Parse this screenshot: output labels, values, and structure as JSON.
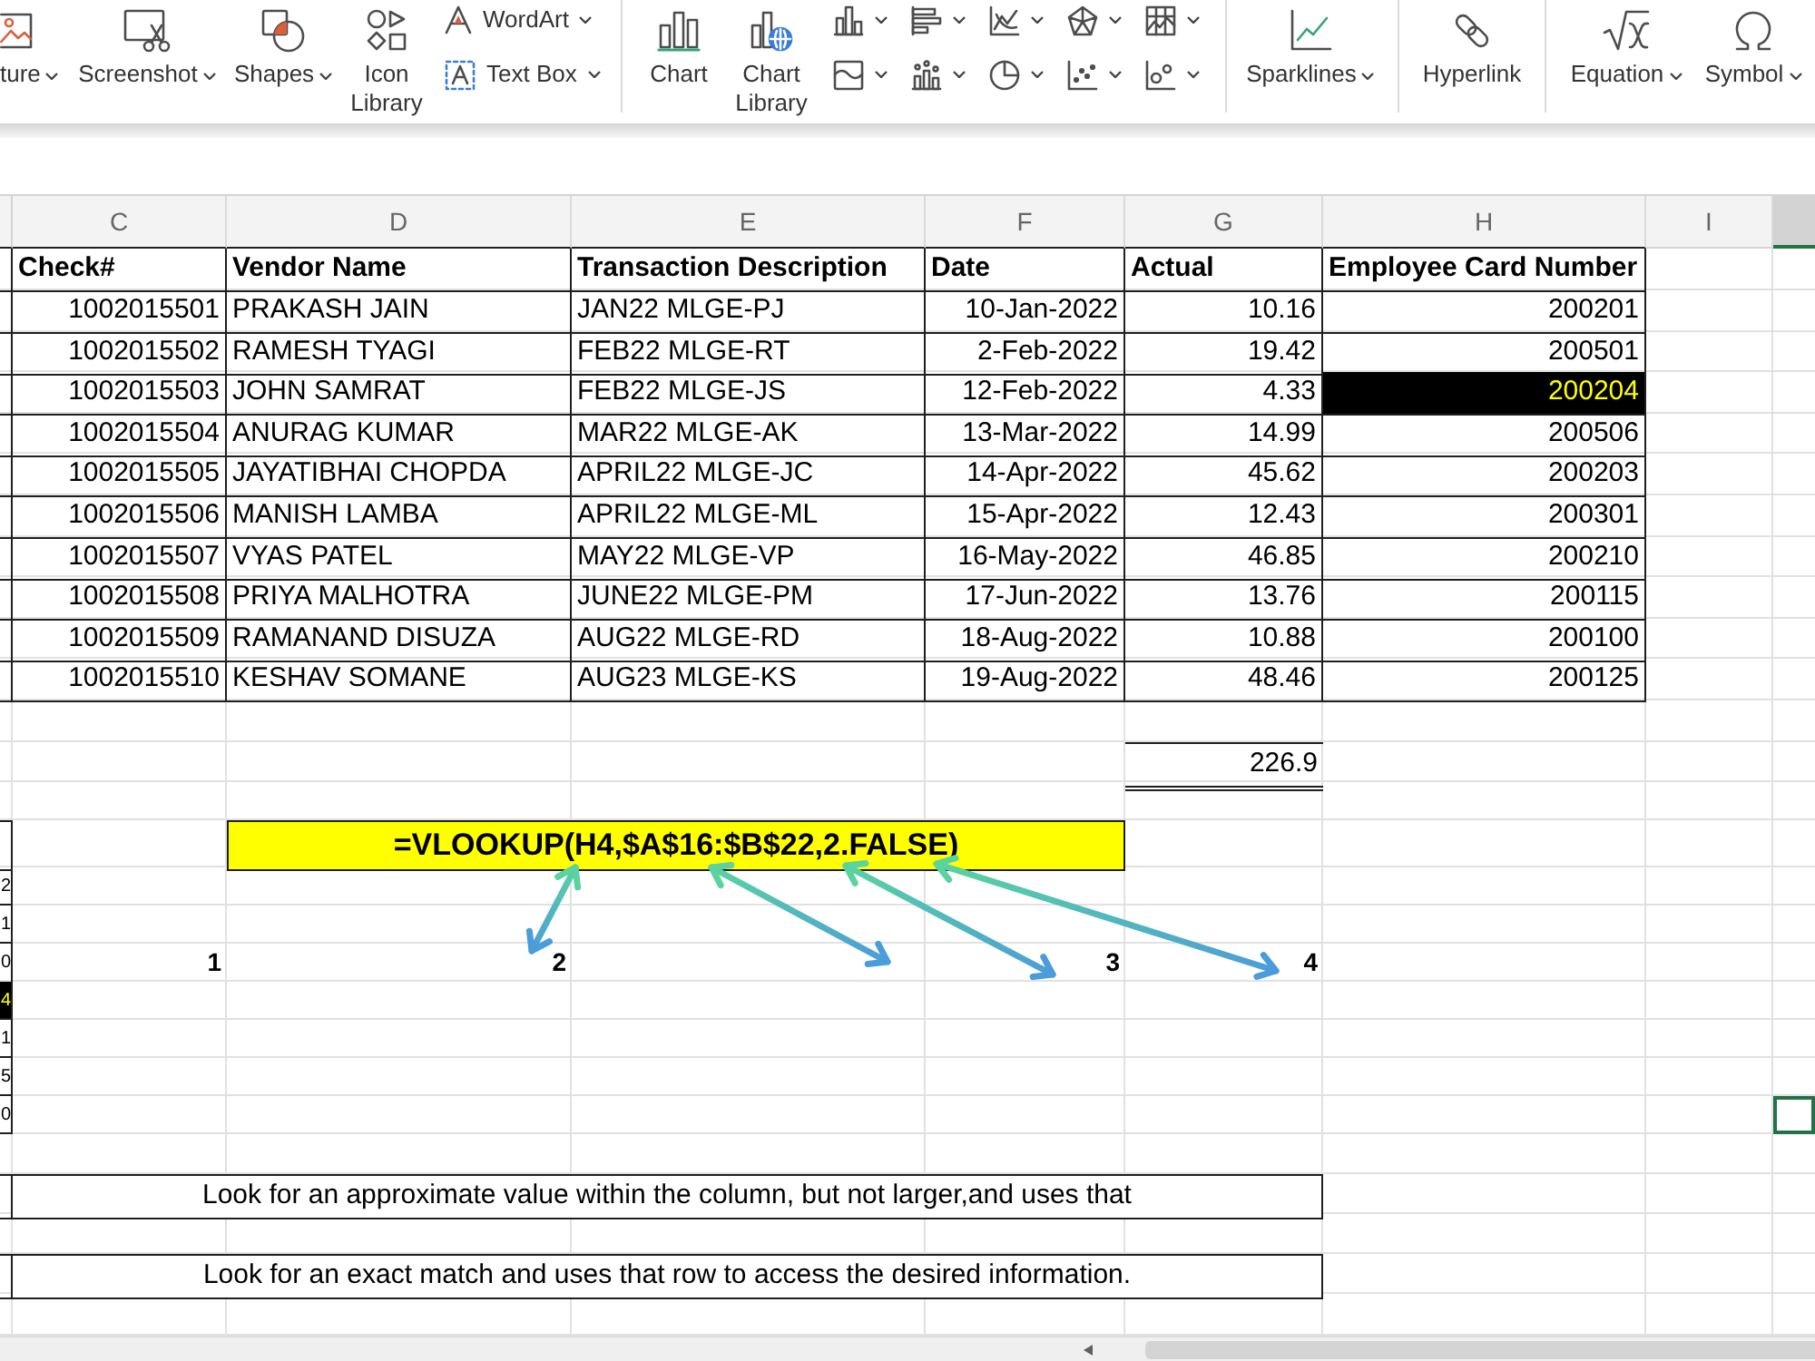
{
  "ribbon": {
    "groups": [
      {
        "items": [
          {
            "kind": "large",
            "label": "ture",
            "dropdown": true
          },
          {
            "kind": "large",
            "label": "Screenshot",
            "dropdown": true
          },
          {
            "kind": "large",
            "label": "Shapes",
            "dropdown": true
          },
          {
            "kind": "large",
            "label": "Icon Library",
            "dropdown": false
          },
          {
            "kind": "small",
            "label": "WordArt",
            "dropdown": true
          },
          {
            "kind": "small",
            "label": "Text Box",
            "dropdown": true
          }
        ]
      },
      {
        "items": [
          {
            "kind": "large",
            "label": "Chart",
            "dropdown": false
          },
          {
            "kind": "large",
            "label": "Chart Library",
            "dropdown": false
          },
          {
            "kind": "gallery",
            "dropdown": true
          },
          {
            "kind": "gallery",
            "dropdown": true
          },
          {
            "kind": "gallery",
            "dropdown": true
          },
          {
            "kind": "gallery",
            "dropdown": true
          },
          {
            "kind": "gallery",
            "dropdown": true
          },
          {
            "kind": "gallery",
            "dropdown": true
          },
          {
            "kind": "gallery",
            "dropdown": true
          },
          {
            "kind": "gallery",
            "dropdown": true
          },
          {
            "kind": "gallery",
            "dropdown": true
          },
          {
            "kind": "gallery",
            "dropdown": true
          }
        ]
      },
      {
        "items": [
          {
            "kind": "large",
            "label": "Sparklines",
            "dropdown": true
          }
        ]
      },
      {
        "items": [
          {
            "kind": "large",
            "label": "Hyperlink",
            "dropdown": false
          }
        ]
      },
      {
        "items": [
          {
            "kind": "large",
            "label": "Equation",
            "dropdown": true
          },
          {
            "kind": "large",
            "label": "Symbol",
            "dropdown": true
          }
        ]
      }
    ]
  },
  "sheet": {
    "column_letters": [
      "C",
      "D",
      "E",
      "F",
      "G",
      "H",
      "I"
    ],
    "active_cell": true,
    "table": {
      "header": [
        "Check#",
        "Vendor Name",
        "Transaction Description",
        "Date",
        "Actual",
        "Employee Card Number"
      ],
      "rows": [
        {
          "cells": [
            "1002015501",
            "PRAKASH JAIN",
            "JAN22 MLGE-PJ",
            "10-Jan-2022",
            "10.16",
            "200201"
          ],
          "card_highlighted": false
        },
        {
          "cells": [
            "1002015502",
            "RAMESH TYAGI",
            "FEB22 MLGE-RT",
            "2-Feb-2022",
            "19.42",
            "200501"
          ],
          "card_highlighted": false
        },
        {
          "cells": [
            "1002015503",
            "JOHN SAMRAT",
            "FEB22 MLGE-JS",
            "12-Feb-2022",
            "4.33",
            "200204"
          ],
          "card_highlighted": true
        },
        {
          "cells": [
            "1002015504",
            "ANURAG KUMAR",
            "MAR22 MLGE-AK",
            "13-Mar-2022",
            "14.99",
            "200506"
          ],
          "card_highlighted": false
        },
        {
          "cells": [
            "1002015505",
            "JAYATIBHAI CHOPDA",
            "APRIL22 MLGE-JC",
            "14-Apr-2022",
            "45.62",
            "200203"
          ],
          "card_highlighted": false
        },
        {
          "cells": [
            "1002015506",
            "MANISH LAMBA",
            "APRIL22 MLGE-ML",
            "15-Apr-2022",
            "12.43",
            "200301"
          ],
          "card_highlighted": false
        },
        {
          "cells": [
            "1002015507",
            "VYAS PATEL",
            "MAY22 MLGE-VP",
            "16-May-2022",
            "46.85",
            "200210"
          ],
          "card_highlighted": false
        },
        {
          "cells": [
            "1002015508",
            "PRIYA MALHOTRA",
            "JUNE22 MLGE-PM",
            "17-Jun-2022",
            "13.76",
            "200115"
          ],
          "card_highlighted": false
        },
        {
          "cells": [
            "1002015509",
            "RAMANAND DISUZA",
            "AUG22 MLGE-RD",
            "18-Aug-2022",
            "10.88",
            "200100"
          ],
          "card_highlighted": false
        },
        {
          "cells": [
            "1002015510",
            "KESHAV SOMANE",
            "AUG23 MLGE-KS",
            "19-Aug-2022",
            "48.46",
            "200125"
          ],
          "card_highlighted": false
        }
      ],
      "total": "226.9"
    },
    "formula": "=VLOOKUP(H4,$A$16:$B$22,2.FALSE)",
    "callouts": [
      "1",
      "2",
      "3",
      "4"
    ],
    "side_column": [
      {
        "value": "2",
        "highlighted": false
      },
      {
        "value": "1",
        "highlighted": false
      },
      {
        "value": "0",
        "highlighted": false
      },
      {
        "value": "4",
        "highlighted": true
      },
      {
        "value": "1",
        "highlighted": false
      },
      {
        "value": "5",
        "highlighted": false
      },
      {
        "value": "0",
        "highlighted": false
      }
    ],
    "notes": [
      "Look for an approximate value within the column, but not larger,and uses that",
      "Look for an exact match and uses that row to access the desired information."
    ]
  }
}
